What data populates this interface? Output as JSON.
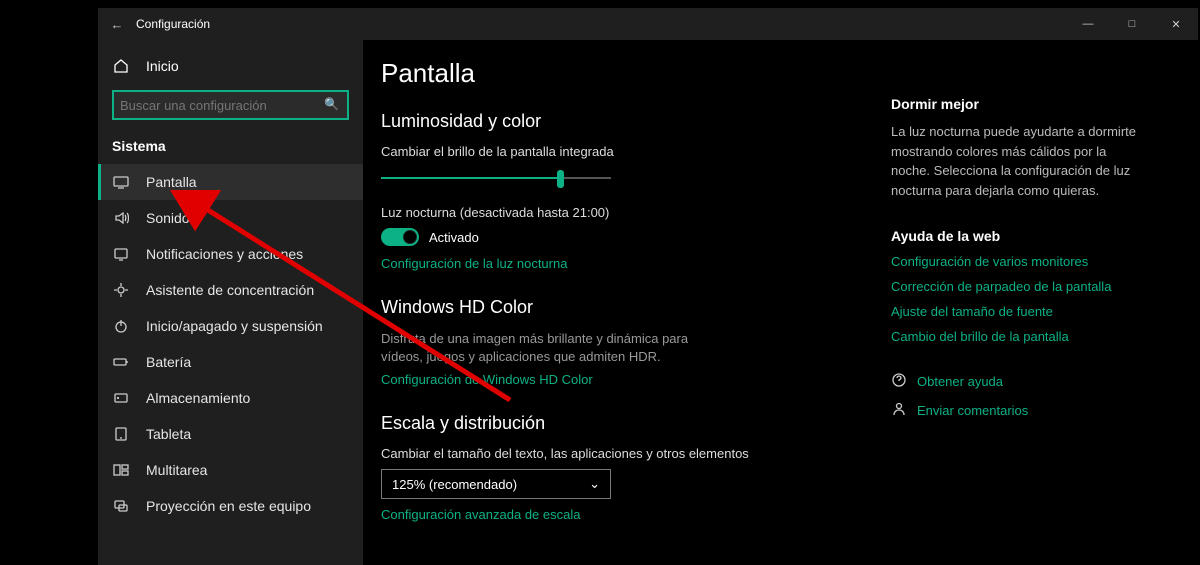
{
  "titlebar": {
    "title": "Configuración"
  },
  "sidebar": {
    "home": "Inicio",
    "search_placeholder": "Buscar una configuración",
    "section": "Sistema",
    "items": [
      {
        "label": "Pantalla",
        "icon": "display-icon",
        "active": true
      },
      {
        "label": "Sonido",
        "icon": "sound-icon"
      },
      {
        "label": "Notificaciones y acciones",
        "icon": "notifications-icon"
      },
      {
        "label": "Asistente de concentración",
        "icon": "focus-icon"
      },
      {
        "label": "Inicio/apagado y suspensión",
        "icon": "power-icon"
      },
      {
        "label": "Batería",
        "icon": "battery-icon"
      },
      {
        "label": "Almacenamiento",
        "icon": "storage-icon"
      },
      {
        "label": "Tableta",
        "icon": "tablet-icon"
      },
      {
        "label": "Multitarea",
        "icon": "multitask-icon"
      },
      {
        "label": "Proyección en este equipo",
        "icon": "project-icon"
      }
    ]
  },
  "main": {
    "title": "Pantalla",
    "brightness": {
      "heading": "Luminosidad y color",
      "slider_label": "Cambiar el brillo de la pantalla integrada",
      "night_light_label": "Luz nocturna (desactivada hasta 21:00)",
      "toggle_state": "Activado",
      "night_light_link": "Configuración de la luz nocturna"
    },
    "hdcolor": {
      "heading": "Windows HD Color",
      "desc": "Disfruta de una imagen más brillante y dinámica para vídeos, juegos y aplicaciones que admiten HDR.",
      "link": "Configuración de Windows HD Color"
    },
    "scale": {
      "heading": "Escala y distribución",
      "label": "Cambiar el tamaño del texto, las aplicaciones y otros elementos",
      "value": "125% (recomendado)",
      "link": "Configuración avanzada de escala"
    }
  },
  "aside": {
    "sleep_h": "Dormir mejor",
    "sleep_text": "La luz nocturna puede ayudarte a dormirte mostrando colores más cálidos por la noche. Selecciona la configuración de luz nocturna para dejarla como quieras.",
    "web_h": "Ayuda de la web",
    "web_links": [
      "Configuración de varios monitores",
      "Corrección de parpadeo de la pantalla",
      "Ajuste del tamaño de fuente",
      "Cambio del brillo de la pantalla"
    ],
    "get_help": "Obtener ayuda",
    "feedback": "Enviar comentarios"
  }
}
